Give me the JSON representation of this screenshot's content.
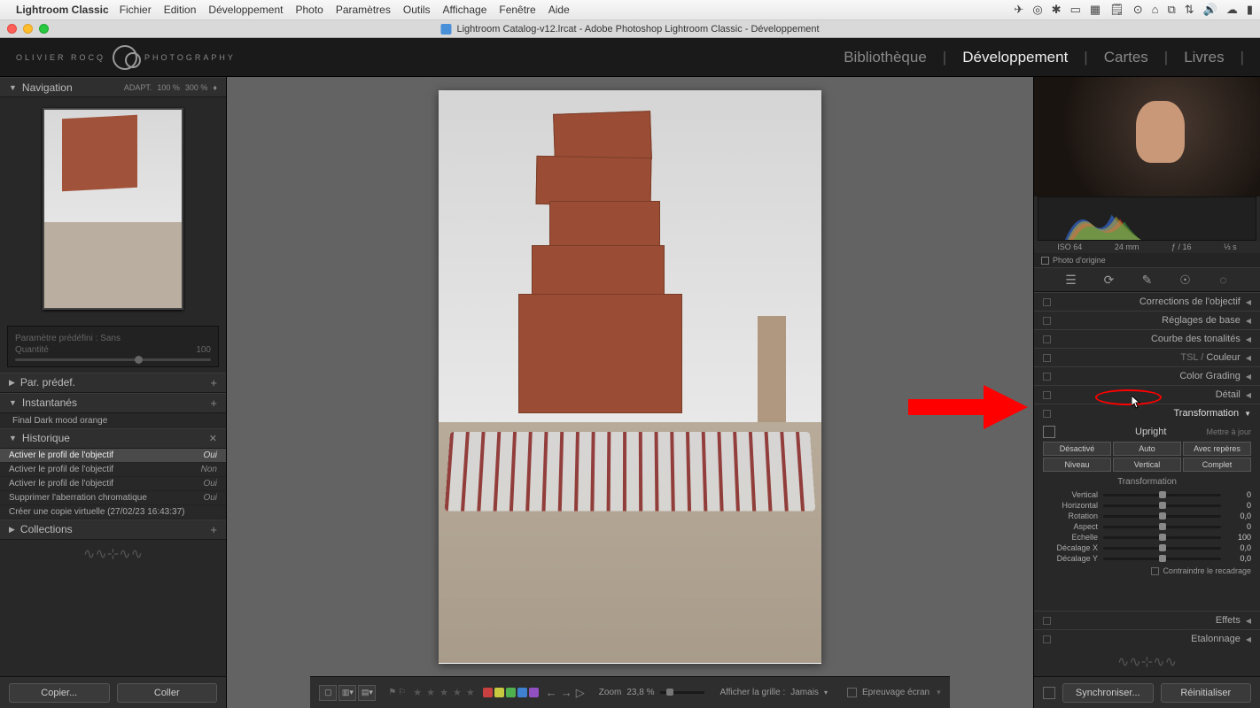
{
  "menubar": {
    "app": "Lightroom Classic",
    "items": [
      "Fichier",
      "Edition",
      "Développement",
      "Photo",
      "Paramètres",
      "Outils",
      "Affichage",
      "Fenêtre",
      "Aide"
    ]
  },
  "window_title": "Lightroom Catalog-v12.lrcat - Adobe Photoshop Lightroom Classic - Développement",
  "logo_text_left": "OLIVIER ROCQ",
  "logo_text_right": "PHOTOGRAPHY",
  "modules": {
    "items": [
      "Bibliothèque",
      "Développement",
      "Cartes",
      "Livres"
    ],
    "active": "Développement"
  },
  "left": {
    "nav": {
      "title": "Navigation",
      "adapt": "ADAPT.",
      "z1": "100 %",
      "z2": "300 %"
    },
    "preset_box": {
      "label": "Paramètre prédéfini : Sans",
      "qty": "Quantité",
      "val": "100"
    },
    "par_predef": "Par. prédef.",
    "instantanes": "Instantanés",
    "snap_item": "Final Dark mood orange",
    "historique": "Historique",
    "history": [
      {
        "label": "Activer le profil de l'objectif",
        "val": "Oui",
        "sel": true
      },
      {
        "label": "Activer le profil de l'objectif",
        "val": "Non",
        "sel": false
      },
      {
        "label": "Activer le profil de l'objectif",
        "val": "Oui",
        "sel": false
      },
      {
        "label": "Supprimer l'aberration chromatique",
        "val": "Oui",
        "sel": false
      },
      {
        "label": "Créer une copie virtuelle (27/02/23 16:43:37)",
        "val": "",
        "sel": false
      }
    ],
    "collections": "Collections",
    "copier": "Copier...",
    "coller": "Coller"
  },
  "right": {
    "meta": {
      "iso": "ISO 64",
      "focal": "24 mm",
      "f": "ƒ / 16",
      "shutter": "⅓ s"
    },
    "origin": "Photo d'origine",
    "sections": {
      "lens": "Corrections de l'objectif",
      "basic": "Réglages de base",
      "tone": "Courbe des tonalités",
      "tsl_prefix": "TSL / ",
      "tsl": "Couleur",
      "grading": "Color Grading",
      "detail": "Détail",
      "transform": "Transformation",
      "effects": "Effets",
      "calib": "Etalonnage"
    },
    "upright": {
      "title": "Upright",
      "update": "Mettre à jour",
      "buttons": [
        "Désactivé",
        "Auto",
        "Avec repères",
        "Niveau",
        "Vertical",
        "Complet"
      ]
    },
    "trans_title": "Transformation",
    "sliders": [
      {
        "label": "Vertical",
        "val": "0"
      },
      {
        "label": "Horizontal",
        "val": "0"
      },
      {
        "label": "Rotation",
        "val": "0,0"
      },
      {
        "label": "Aspect",
        "val": "0"
      },
      {
        "label": "Echelle",
        "val": "100"
      },
      {
        "label": "Décalage X",
        "val": "0,0"
      },
      {
        "label": "Décalage Y",
        "val": "0,0"
      }
    ],
    "constrain": "Contraindre le recadrage",
    "sync": "Synchroniser...",
    "reset": "Réinitialiser"
  },
  "bottom": {
    "zoom_lbl": "Zoom",
    "zoom_val": "23,8 %",
    "grid_lbl": "Afficher la grille :",
    "grid_val": "Jamais",
    "proof": "Epreuvage écran"
  },
  "colors": {
    "red": "#ff595e",
    "yel": "#ffca3a",
    "grn": "#8ac926",
    "cya": "#1982c4",
    "blu": "#3a5fcc",
    "pur": "#6a4c93"
  }
}
